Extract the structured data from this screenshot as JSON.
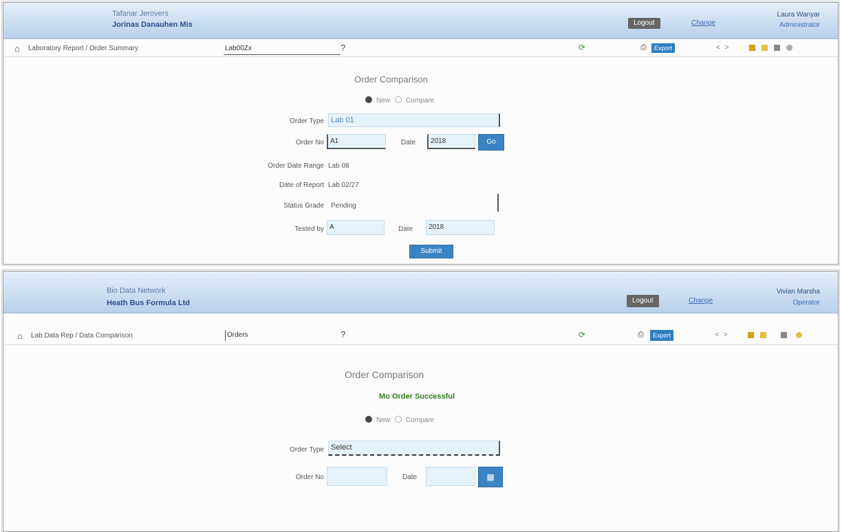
{
  "panel1": {
    "brand_line1": "Tafanar Jerovers",
    "brand_line2": "Jorinas Danauhen Mis",
    "logout_label": "Logout",
    "help_link": "Change",
    "user_name": "Laura Wanyar",
    "user_role": "Administrator",
    "home_icon": "home-icon",
    "breadcrumb": "Laboratory Report / Order Summary",
    "combo_value": "Lab00Zx",
    "help_icon_glyph": "?",
    "refresh_icon": "refresh-icon",
    "print_icon": "print-icon",
    "export_label": "Export",
    "nav_glyphs": "< >",
    "form_title": "Order Comparison",
    "radio_selected": "New",
    "radio_other": "Compare",
    "ordertype_label": "Order Type",
    "ordertype_value": "Lab 01",
    "orderno_label": "Order No",
    "orderno_value": "A1",
    "date_label": "Date",
    "date_value": "2018",
    "go_label": "Go",
    "ordered_label": "Order Date Range",
    "ordered_value": "Lab 08",
    "reported_label": "Date of Report",
    "reported_value": "Lab 02/27",
    "status_label": "Status Grade",
    "status_value": "Pending",
    "tested_label": "Tested by",
    "tested_value": "A",
    "tested_date_label": "Date",
    "tested_date_value": "2018",
    "submit_label": "Submit"
  },
  "panel2": {
    "brand_line1": "Bio Data Network",
    "brand_line2": "Heath Bus Formula Ltd",
    "logout_label": "Logout",
    "help_link": "Change",
    "user_name": "Vivian Marsha",
    "user_role": "Operator",
    "breadcrumb": "Lab Data Rep / Data Comparison",
    "combo_value": "Orders",
    "help_icon_glyph": "?",
    "export_label": "Export",
    "nav_glyphs": "< >",
    "form_title": "Order Comparison",
    "success_message": "Mo Order Successful",
    "radio_selected": "New",
    "radio_other": "Compare",
    "ordertype_label": "Order Type",
    "ordertype_value": "Select",
    "orderno_label": "Order No",
    "orderno_value": "",
    "date_label": "Date",
    "date_value": ""
  },
  "colors": {
    "header_gradient_top": "#e6eef8",
    "header_gradient_bottom": "#b8d0ec",
    "accent_blue": "#3b84c4",
    "success_green": "#2e7d1c",
    "input_bg": "#e6f2fa"
  }
}
